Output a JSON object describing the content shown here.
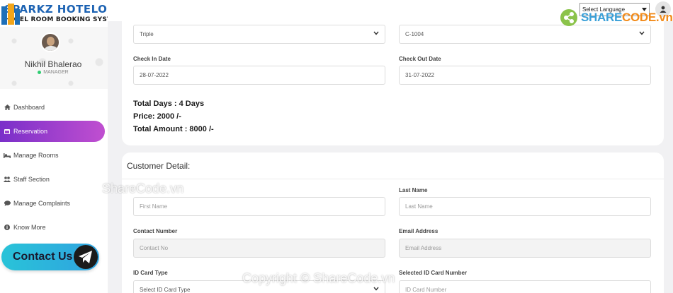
{
  "brand": {
    "title": "SPARKZ HOTELO",
    "subtitle": "HOTEL ROOM BOOKING SYST"
  },
  "profile": {
    "name": "Nikhil Bhalerao",
    "role": "MANAGER"
  },
  "nav": [
    {
      "label": "Dashboard",
      "icon": "dashboard-icon"
    },
    {
      "label": "Reservation",
      "icon": "calendar-icon",
      "active": true
    },
    {
      "label": "Manage Rooms",
      "icon": "bed-icon"
    },
    {
      "label": "Staff Section",
      "icon": "users-icon"
    },
    {
      "label": "Manage Complaints",
      "icon": "chat-icon"
    },
    {
      "label": "Know More",
      "icon": "info-icon"
    }
  ],
  "contact": {
    "label": "Contact Us",
    "icon": "telegram-icon"
  },
  "topbar": {
    "language_select": "Select Language",
    "user_icon": "user-icon"
  },
  "booking": {
    "room_type": "Triple",
    "room_no": "C-1004",
    "check_in_label": "Check In Date",
    "check_in_value": "28-07-2022",
    "check_out_label": "Check Out Date",
    "check_out_value": "31-07-2022",
    "total_days": "Total Days : 4 Days",
    "price": "Price: 2000 /-",
    "total_amount": "Total Amount : 8000 /-"
  },
  "customer": {
    "title": "Customer Detail:",
    "last_name_label": "Last Name",
    "first_name_placeholder": "First Name",
    "last_name_placeholder": "Last Name",
    "contact_label": "Contact Number",
    "contact_placeholder": "Contact No",
    "email_label": "Email Address",
    "email_placeholder": "Email Address",
    "id_type_label": "ID Card Type",
    "id_type_value": "Select ID Card Type",
    "id_number_label": "Selected ID Card Number",
    "id_number_placeholder": "ID Card Number"
  },
  "watermarks": {
    "logo_text_a": "SHARE",
    "logo_text_b": "CODE.vn",
    "text1": "ShareCode.vn",
    "text2": "Copyright © ShareCode.vn"
  },
  "colors": {
    "active_nav_start": "#7a2fc9",
    "active_nav_end": "#c04fd0",
    "contact_button": "#29c3d8",
    "brand_blue": "#1d63b3"
  }
}
